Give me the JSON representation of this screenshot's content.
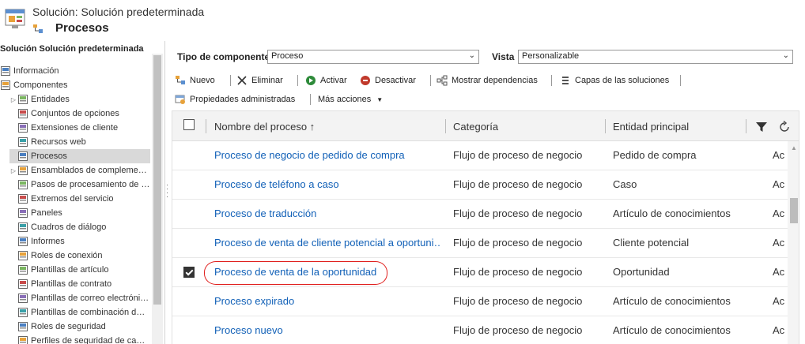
{
  "header": {
    "subtitle": "Solución: Solución predeterminada",
    "title": "Procesos"
  },
  "sidebar": {
    "title": "Solución Solución predeterminada",
    "items": [
      {
        "label": "Información",
        "icon": "info-icon",
        "level": 0
      },
      {
        "label": "Componentes",
        "icon": "components-icon",
        "level": 0
      },
      {
        "label": "Entidades",
        "icon": "entity-icon",
        "level": 1,
        "expandable": true
      },
      {
        "label": "Conjuntos de opciones",
        "icon": "optionset-icon",
        "level": 1
      },
      {
        "label": "Extensiones de cliente",
        "icon": "client-extension-icon",
        "level": 1
      },
      {
        "label": "Recursos web",
        "icon": "web-resource-icon",
        "level": 1
      },
      {
        "label": "Procesos",
        "icon": "process-icon",
        "level": 1,
        "selected": true
      },
      {
        "label": "Ensamblados de compleme…",
        "icon": "plugin-assembly-icon",
        "level": 1,
        "expandable": true
      },
      {
        "label": "Pasos de procesamiento de …",
        "icon": "processing-step-icon",
        "level": 1
      },
      {
        "label": "Extremos del servicio",
        "icon": "service-endpoint-icon",
        "level": 1
      },
      {
        "label": "Paneles",
        "icon": "dashboard-icon",
        "level": 1
      },
      {
        "label": "Cuadros de diálogo",
        "icon": "dialog-icon",
        "level": 1
      },
      {
        "label": "Informes",
        "icon": "report-icon",
        "level": 1
      },
      {
        "label": "Roles de conexión",
        "icon": "connection-role-icon",
        "level": 1
      },
      {
        "label": "Plantillas de artículo",
        "icon": "article-template-icon",
        "level": 1
      },
      {
        "label": "Plantillas de contrato",
        "icon": "contract-template-icon",
        "level": 1
      },
      {
        "label": "Plantillas de correo electróni…",
        "icon": "email-template-icon",
        "level": 1
      },
      {
        "label": "Plantillas de combinación d…",
        "icon": "mail-merge-icon",
        "level": 1
      },
      {
        "label": "Roles de seguridad",
        "icon": "security-role-icon",
        "level": 1
      },
      {
        "label": "Perfiles de seguridad de ca…",
        "icon": "field-security-icon",
        "level": 1
      }
    ]
  },
  "filters": {
    "component_type_label": "Tipo de componente",
    "component_type_value": "Proceso",
    "view_label": "Vista",
    "view_value": "Personalizable"
  },
  "toolbar": {
    "new": "Nuevo",
    "delete": "Eliminar",
    "activate": "Activar",
    "deactivate": "Desactivar",
    "show_dependencies": "Mostrar dependencias",
    "solution_layers": "Capas de las soluciones",
    "managed_properties": "Propiedades administradas",
    "more_actions": "Más acciones"
  },
  "grid": {
    "columns": {
      "name": "Nombre del proceso ↑",
      "category": "Categoría",
      "entity": "Entidad principal"
    },
    "rows": [
      {
        "name": "Proceso de negocio de pedido de compra",
        "category": "Flujo de proceso de negocio",
        "entity": "Pedido de compra",
        "status": "Ac",
        "checked": false
      },
      {
        "name": "Proceso de teléfono a caso",
        "category": "Flujo de proceso de negocio",
        "entity": "Caso",
        "status": "Ac",
        "checked": false
      },
      {
        "name": "Proceso de traducción",
        "category": "Flujo de proceso de negocio",
        "entity": "Artículo de conocimientos",
        "status": "Ac",
        "checked": false
      },
      {
        "name": "Proceso de venta de cliente potencial a oportuni…",
        "category": "Flujo de proceso de negocio",
        "entity": "Cliente potencial",
        "status": "Ac",
        "checked": false
      },
      {
        "name": "Proceso de venta de la oportunidad",
        "category": "Flujo de proceso de negocio",
        "entity": "Oportunidad",
        "status": "Ac",
        "checked": true
      },
      {
        "name": "Proceso expirado",
        "category": "Flujo de proceso de negocio",
        "entity": "Artículo de conocimientos",
        "status": "Ac",
        "checked": false
      },
      {
        "name": "Proceso nuevo",
        "category": "Flujo de proceso de negocio",
        "entity": "Artículo de conocimientos",
        "status": "Ac",
        "checked": false
      }
    ]
  },
  "colors": {
    "link": "#1160b7",
    "highlight": "#e0201e"
  }
}
